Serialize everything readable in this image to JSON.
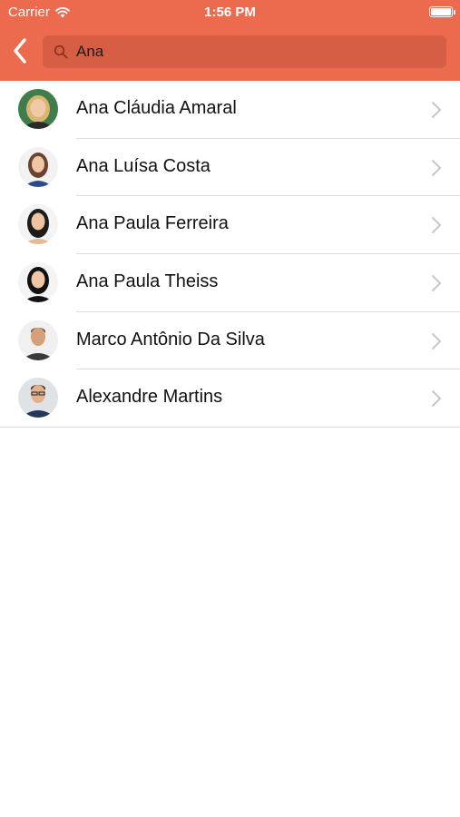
{
  "status_bar": {
    "carrier": "Carrier",
    "time": "1:56 PM"
  },
  "navigation": {
    "back_icon": "chevron-left-icon",
    "search": {
      "value": "Ana",
      "icon": "search-icon"
    }
  },
  "results": [
    {
      "name": "Ana Cláudia Amaral"
    },
    {
      "name": "Ana Luísa Costa"
    },
    {
      "name": "Ana Paula Ferreira"
    },
    {
      "name": "Ana Paula Theiss"
    },
    {
      "name": "Marco Antônio Da Silva"
    },
    {
      "name": "Alexandre Martins"
    }
  ],
  "colors": {
    "accent": "#EC6B4E",
    "search_field": "#D65E45",
    "separator": "#DCDCDC",
    "chevron": "#C7C7CC"
  }
}
